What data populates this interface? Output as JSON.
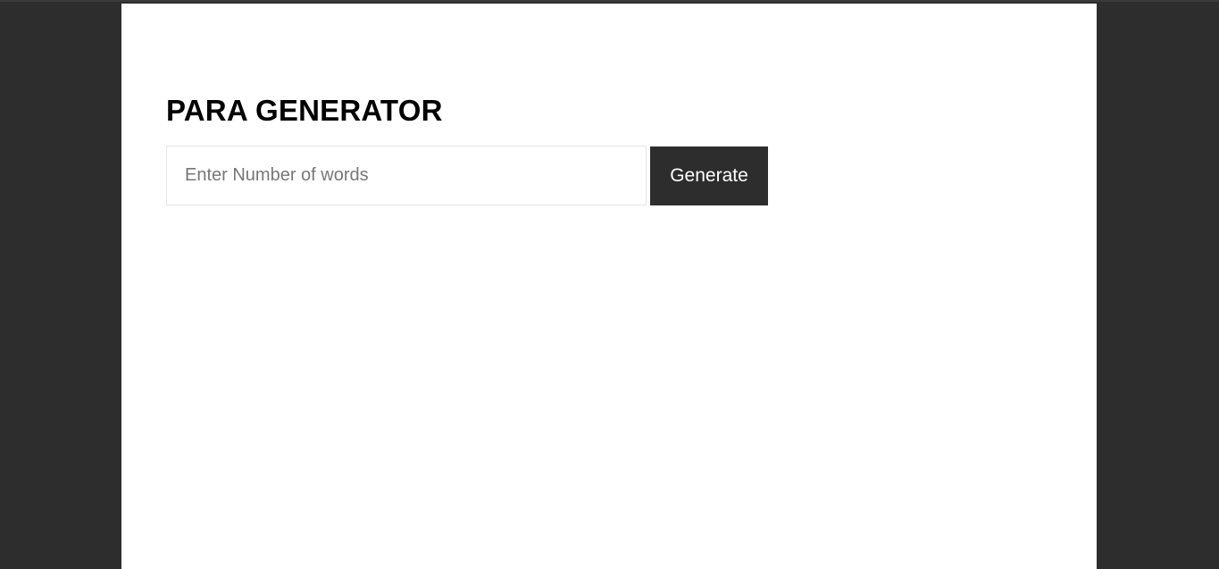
{
  "app": {
    "title": "PARA GENERATOR"
  },
  "form": {
    "input_placeholder": "Enter Number of words",
    "input_value": "",
    "generate_label": "Generate"
  },
  "colors": {
    "background_dark": "#2d2d2d",
    "panel": "#ffffff",
    "button_bg": "#2d2d2d",
    "button_text": "#ffffff",
    "title_text": "#000000"
  }
}
